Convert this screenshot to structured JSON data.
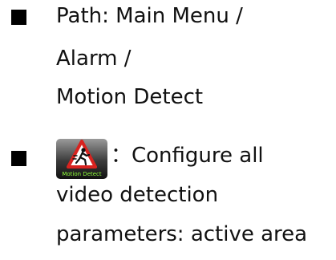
{
  "bullets": [
    {
      "lines": [
        "Path: Main Menu /",
        "Alarm /",
        "Motion Detect"
      ]
    },
    {
      "icon": {
        "name": "motion-detect-icon",
        "caption": "Motion Detect"
      },
      "first_line_suffix": "：Configure all",
      "lines": [
        "video detection",
        "parameters: active area"
      ]
    }
  ],
  "colors": {
    "text": "#111111",
    "icon_caption": "#8fff3a",
    "warning_red": "#d8231f"
  }
}
